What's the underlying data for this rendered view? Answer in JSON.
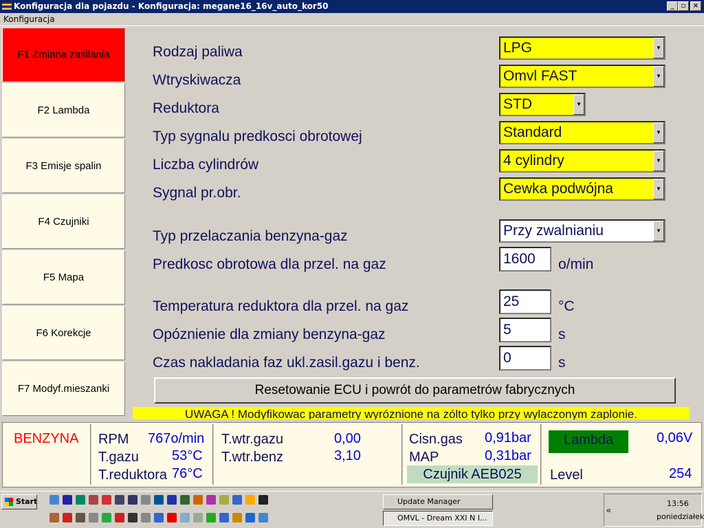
{
  "window": {
    "title": "Konfiguracja dla pojazdu - Konfiguracja: megane16_16v_auto_kor50"
  },
  "menu": {
    "konfiguracja": "Konfiguracja"
  },
  "sidebar": [
    {
      "label": "F1 Zmiana zasilania",
      "active": true
    },
    {
      "label": "F2 Lambda"
    },
    {
      "label": "F3 Emisje spalin"
    },
    {
      "label": "F4 Czujniki"
    },
    {
      "label": "F5 Mapa"
    },
    {
      "label": "F6 Korekcje"
    },
    {
      "label": "F7 Modyf.mieszanki"
    }
  ],
  "form": {
    "rodzaj_paliwa": {
      "label": "Rodzaj paliwa",
      "value": "LPG"
    },
    "wtryskiwacza": {
      "label": "Wtryskiwacza",
      "value": "Omvl FAST"
    },
    "reduktora": {
      "label": "Reduktora",
      "value": "STD"
    },
    "typ_sygnalu": {
      "label": "Typ sygnalu predkosci obrotowej",
      "value": "Standard"
    },
    "liczba_cylindrow": {
      "label": "Liczba cylindrów",
      "value": "4 cylindry"
    },
    "sygnal": {
      "label": "Sygnal pr.obr.",
      "value": "Cewka podwójna"
    },
    "typ_przelaczania": {
      "label": "Typ przelaczania benzyna-gaz",
      "value": "Przy zwalnianiu"
    },
    "predkosc": {
      "label": "Predkosc obrotowa dla przel. na gaz",
      "value": "1600",
      "unit": "o/min"
    },
    "temperatura": {
      "label": "Temperatura reduktora dla przel. na gaz",
      "value": "25",
      "unit": "°C"
    },
    "opoznienie": {
      "label": "Opóznienie dla zmiany benzyna-gaz",
      "value": "5",
      "unit": "s"
    },
    "czas": {
      "label": "Czas nakladania faz ukl.zasil.gazu i benz.",
      "value": "0",
      "unit": "s"
    }
  },
  "reset_label": "Resetowanie ECU i powrót do parametrów fabrycznych",
  "warning": "UWAGA ! Modyfikowac parametry wyróznione na zólto tylko przy wylaczonym zaplonie.",
  "status": {
    "fuel": "BENZYNA",
    "rpm_label": "RPM",
    "rpm": "767o/min",
    "tgazu_label": "T.gazu",
    "tgazu": "53°C",
    "tred_label": "T.reduktora",
    "tred": "76°C",
    "twtrgazu_label": "T.wtr.gazu",
    "twtrgazu": "0,00",
    "twtrbenz_label": "T.wtr.benz",
    "twtrbenz": "3,10",
    "cisn_label": "Cisn.gas",
    "cisn": "0,91bar",
    "map_label": "MAP",
    "map": "0,31bar",
    "czujnik": "Czujnik AEB025",
    "lambda_label": "Lambda",
    "lambda": "0,06V",
    "level_label": "Level",
    "level": "254"
  },
  "taskbar": {
    "start": "Start",
    "tasks": [
      "Update Manager",
      "OMVL - Dream XXI N I..."
    ],
    "time": "13:56",
    "day": "poniedziałek"
  }
}
